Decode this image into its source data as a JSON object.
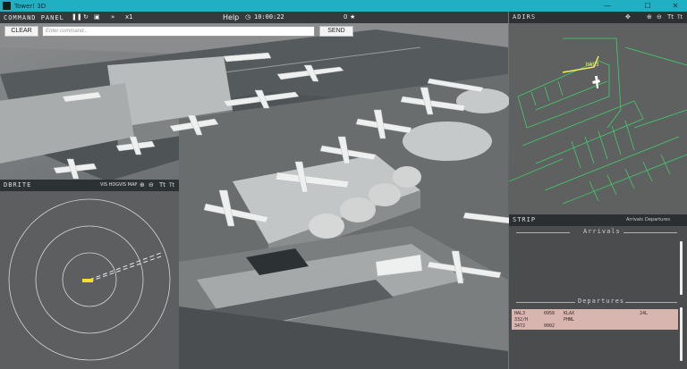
{
  "window": {
    "title": "Tower! 3D",
    "minimize": "—",
    "maximize": "☐",
    "close": "✕"
  },
  "command_panel": {
    "title": "COMMAND PANEL",
    "pause": "❚❚",
    "replay": "↻",
    "camera": "▣",
    "speed_icon": "»",
    "speed": "x1",
    "help": "Help",
    "clock": "10:00:22",
    "score": "0",
    "star": "★",
    "clear_label": "CLEAR",
    "send_label": "SEND",
    "input_placeholder": "Enter command..."
  },
  "adirs": {
    "title": "ADIRS",
    "move": "✥",
    "zoom_in": "⊕",
    "zoom_out": "⊖",
    "text_up": "Tt",
    "text_down": "Tt",
    "aircraft_label": "HAL3"
  },
  "dbrite": {
    "title": "DBRITE",
    "vis_hdg": "VIS HDG",
    "vis_map": "VIS MAP",
    "zoom_in": "⊕",
    "zoom_out": "⊖",
    "text_up": "Tt",
    "text_down": "Tt"
  },
  "strip": {
    "title": "STRIP",
    "tab_arrivals": "Arrivals",
    "tab_departures": "Departures",
    "arrivals_title": "Arrivals",
    "departures_title": "Departures",
    "departure_strips": [
      {
        "callsign": "HAL3",
        "type": "332/H",
        "squawk": "3472",
        "time": "0958",
        "time2": "0002",
        "destination": "KLAX",
        "origin": "PHNL",
        "runway": "24L"
      }
    ]
  },
  "colors": {
    "titlebar": "#1fb0c4",
    "adirs_lines": "#3fcf6a",
    "adirs_aircraft": "#f3ee54",
    "radar_target": "#f4e02a",
    "strip_bg": "#d8b5ae"
  }
}
